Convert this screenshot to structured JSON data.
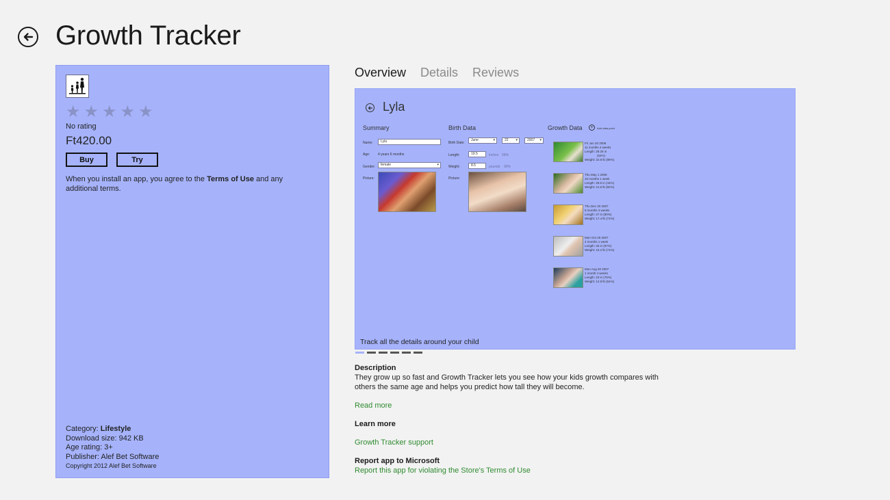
{
  "header": {
    "title": "Growth Tracker",
    "back_icon": "back-arrow-icon"
  },
  "info": {
    "rating_text": "No rating",
    "stars": 5,
    "price": "Ft420.00",
    "buy_label": "Buy",
    "try_label": "Try",
    "terms_before": "When you install an app, you agree to the ",
    "terms_link": "Terms of Use",
    "terms_after": " and any additional terms.",
    "category_label": "Category: ",
    "category_value": "Lifestyle",
    "download_size": "Download size: 942 KB",
    "age_rating": "Age rating: 3+",
    "publisher": "Publisher: Alef Bet Software",
    "copyright": "Copyright 2012 Alef Bet Software"
  },
  "tabs": [
    {
      "label": "Overview",
      "active": true
    },
    {
      "label": "Details",
      "active": false
    },
    {
      "label": "Reviews",
      "active": false
    }
  ],
  "screenshot": {
    "caption": "Track all the details around your child",
    "page_count": 6,
    "current_page": 1,
    "mock": {
      "name": "Lyla",
      "summary_title": "Summary",
      "birth_title": "Birth Data",
      "growth_title": "Growth Data",
      "add_point": "Add data point",
      "name_label": "Name:",
      "name_value": "Lyla",
      "age_label": "Age:",
      "age_value": "4 years 6 months",
      "gender_label": "Gender:",
      "gender_value": "female",
      "picture_label": "Picture:",
      "birth_date_label": "Birth Date:",
      "birth_month": "June",
      "birth_day": "22",
      "birth_year": "2007",
      "length_label": "Length:",
      "length_value": "19.5",
      "length_unit": "inches",
      "length_pct": "59%",
      "weight_label": "Weight:",
      "weight_value": "8.5",
      "weight_unit": "pounds",
      "weight_pct": "90%",
      "growth_items": [
        {
          "date": "Fri Jun 20 2008",
          "age": "11 months 4 weeks",
          "length": "Length:   29.25 in",
          "length2": "(54%)",
          "weight": "Weight:   22.8 lb (88%)"
        },
        {
          "date": "Thu May 1 2008",
          "age": "10 months 1 week",
          "length": "Length:   28.5 in (44%)",
          "length2": "",
          "weight": "Weight:   21.5 lb (82%)"
        },
        {
          "date": "Thu Dec 20 2007",
          "age": "5 months 4 weeks",
          "length": "Length:   27 in (80%)",
          "length2": "",
          "weight": "Weight:   17.4 lb (74%)"
        },
        {
          "date": "Mon Oct 29 2007",
          "age": "4 months 1 week",
          "length": "Length:   26 in (97%)",
          "length2": "",
          "weight": "Weight:   15.2 lb (74%)"
        },
        {
          "date": "Mon Aug 20 2007",
          "age": "1 month 4 weeks",
          "length": "Length:   23 in (75%)",
          "length2": "",
          "weight": "Weight:   12.8 lb (64%)"
        }
      ]
    }
  },
  "description": {
    "title": "Description",
    "text": "They grow up so fast and Growth Tracker lets you see how your kids growth compares with others the same age and helps you predict how tall they will become.",
    "read_more": "Read more"
  },
  "learn_more": {
    "title": "Learn more",
    "link": "Growth Tracker support"
  },
  "report": {
    "title": "Report app to Microsoft",
    "link": "Report this app for violating the Store's Terms of Use"
  }
}
